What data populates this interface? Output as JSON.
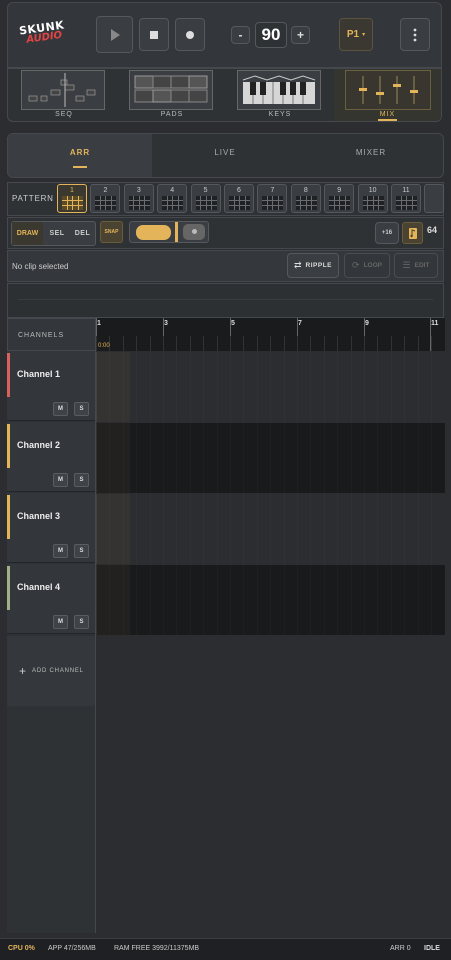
{
  "app": {
    "logo_line1": "SKUNK",
    "logo_line2": "AUDIO",
    "tempo": "90",
    "tempo_minus": "-",
    "tempo_plus": "+",
    "preset": "P1"
  },
  "modes": [
    {
      "label": "SEQ"
    },
    {
      "label": "PADS"
    },
    {
      "label": "KEYS"
    },
    {
      "label": "MIX"
    }
  ],
  "views": {
    "tabs": [
      "ARR",
      "LIVE",
      "MIXER"
    ],
    "active": "ARR"
  },
  "pattern": {
    "label": "PATTERN",
    "numbers": [
      "1",
      "2",
      "3",
      "4",
      "5",
      "6",
      "7",
      "8",
      "9",
      "10",
      "11"
    ],
    "selected": "1"
  },
  "tools": {
    "draw": "DRAW",
    "sel": "SEL",
    "del": "DEL",
    "snap": "SNAP",
    "plus16": "+16",
    "length": "64"
  },
  "clip": {
    "status": "No clip selected",
    "ripple": "RIPPLE",
    "loop": "LOOP",
    "edit": "EDIT"
  },
  "timeline": {
    "channels_header": "CHANNELS",
    "bars": [
      "1",
      "3",
      "5",
      "7",
      "9",
      "11"
    ],
    "playhead": "0:00"
  },
  "channels": [
    {
      "name": "Channel 1",
      "color": "#d9615b",
      "mute": "M",
      "solo": "S"
    },
    {
      "name": "Channel 2",
      "color": "#e3b45a",
      "mute": "M",
      "solo": "S"
    },
    {
      "name": "Channel 3",
      "color": "#e3b45a",
      "mute": "M",
      "solo": "S"
    },
    {
      "name": "Channel 4",
      "color": "#9fb08a",
      "mute": "M",
      "solo": "S"
    }
  ],
  "add_channel": "ADD CHANNEL",
  "status": {
    "cpu": "CPU 0%",
    "app": "APP 47/256MB",
    "ram": "RAM FREE 3992/11375MB",
    "arr": "ARR 0",
    "state": "IDLE"
  },
  "colors": {
    "accent": "#e3b45a",
    "bg": "#2b2d30"
  }
}
